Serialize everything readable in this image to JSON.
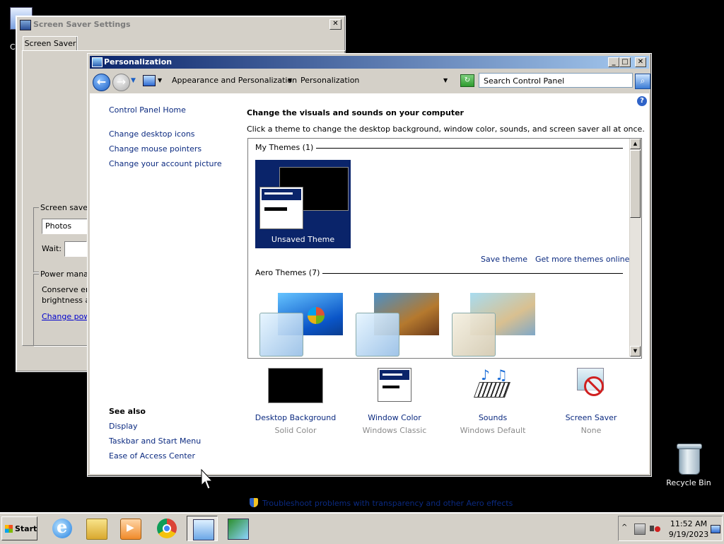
{
  "desktop": {
    "recycle_bin_label": "Recycle Bin",
    "partial_icon_label": "C"
  },
  "screen_saver_window": {
    "title": "Screen Saver Settings",
    "tab": "Screen Saver",
    "group_label": "Screen saver",
    "selected_saver": "Photos",
    "wait_label": "Wait:",
    "wait_value": "",
    "power_group_label": "Power mana",
    "power_text_line1": "Conserve en",
    "power_text_line2": "brightness a",
    "power_link": "Change pow",
    "close_glyph": "✕"
  },
  "personalization_window": {
    "title": "Personalization",
    "controls": {
      "minimize": "_",
      "maximize": "□",
      "close": "✕"
    },
    "nav": {
      "back_glyph": "←",
      "forward_glyph": "→",
      "breadcrumbs": [
        "Appearance and Personalization",
        "Personalization"
      ],
      "search_placeholder": "Search Control Panel"
    },
    "sidebar": {
      "home_link": "Control Panel Home",
      "links": [
        "Change desktop icons",
        "Change mouse pointers",
        "Change your account picture"
      ],
      "see_also_heading": "See also",
      "see_also_links": [
        "Display",
        "Taskbar and Start Menu",
        "Ease of Access Center"
      ]
    },
    "main": {
      "heading": "Change the visuals and sounds on your computer",
      "subheading": "Click a theme to change the desktop background, window color, sounds, and screen saver all at once.",
      "my_themes_label": "My Themes (1)",
      "unsaved_theme_label": "Unsaved Theme",
      "save_theme_link": "Save theme",
      "more_themes_link": "Get more themes online",
      "aero_themes_label": "Aero Themes (7)",
      "aero_theme_icons": [
        "windows-7-theme",
        "architecture-theme",
        "characters-theme"
      ],
      "settings": [
        {
          "label": "Desktop Background",
          "value": "Solid Color",
          "icon": "desktop-background-icon"
        },
        {
          "label": "Window Color",
          "value": "Windows Classic",
          "icon": "window-color-icon"
        },
        {
          "label": "Sounds",
          "value": "Windows Default",
          "icon": "sounds-icon"
        },
        {
          "label": "Screen Saver",
          "value": "None",
          "icon": "screen-saver-icon"
        }
      ],
      "troubleshoot_link": "Troubleshoot problems with transparency and other Aero effects"
    },
    "help_glyph": "?"
  },
  "taskbar": {
    "start_label": "Start",
    "buttons": [
      "internet-explorer",
      "windows-explorer",
      "media-player",
      "chrome",
      "control-panel",
      "personalization"
    ],
    "tray": {
      "time": "11:52 AM",
      "date": "9/19/2023",
      "overflow_glyph": "^"
    }
  },
  "colors": {
    "classic_face": "#d4d0c8",
    "title_active_start": "#0a246a",
    "title_active_end": "#a6caf0",
    "link": "#0b2a80",
    "secondary_text": "#8a8a8a"
  }
}
